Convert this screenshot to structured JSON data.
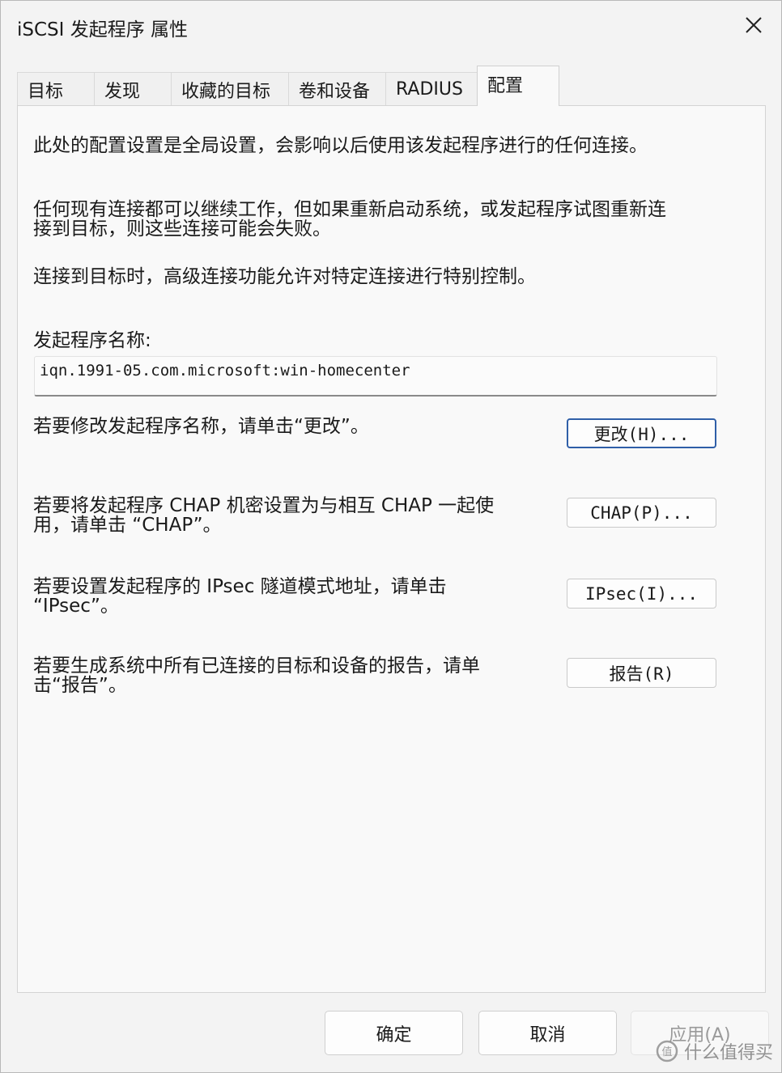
{
  "window": {
    "title": "iSCSI 发起程序 属性"
  },
  "tabs": [
    {
      "label": "目标"
    },
    {
      "label": "发现"
    },
    {
      "label": "收藏的目标"
    },
    {
      "label": "卷和设备"
    },
    {
      "label": "RADIUS"
    },
    {
      "label": "配置"
    }
  ],
  "config": {
    "intro": "此处的配置设置是全局设置，会影响以后使用该发起程序进行的任何连接。",
    "existing_line1": "任何现有连接都可以继续工作，但如果重新启动系统，或发起程序试图重新连",
    "existing_line2": "接到目标，则这些连接可能会失败。",
    "advanced": "连接到目标时，高级连接功能允许对特定连接进行特别控制。",
    "initiator_name_label": "发起程序名称:",
    "initiator_name_value": "iqn.1991-05.com.microsoft:win-homecenter",
    "change_desc": "若要修改发起程序名称，请单击“更改”。",
    "change_button": "更改(H)...",
    "chap_desc_line1": "若要将发起程序 CHAP 机密设置为与相互 CHAP 一起使",
    "chap_desc_line2": "用，请单击 “CHAP”。",
    "chap_button": "CHAP(P)...",
    "ipsec_desc_line1": "若要设置发起程序的 IPsec 隧道模式地址，请单击",
    "ipsec_desc_line2": "“IPsec”。",
    "ipsec_button": "IPsec(I)...",
    "report_desc_line1": "若要生成系统中所有已连接的目标和设备的报告，请单",
    "report_desc_line2": "击“报告”。",
    "report_button": "报告(R)"
  },
  "footer": {
    "ok": "确定",
    "cancel": "取消",
    "apply": "应用(A)"
  },
  "watermark": {
    "text": "什么值得买"
  }
}
